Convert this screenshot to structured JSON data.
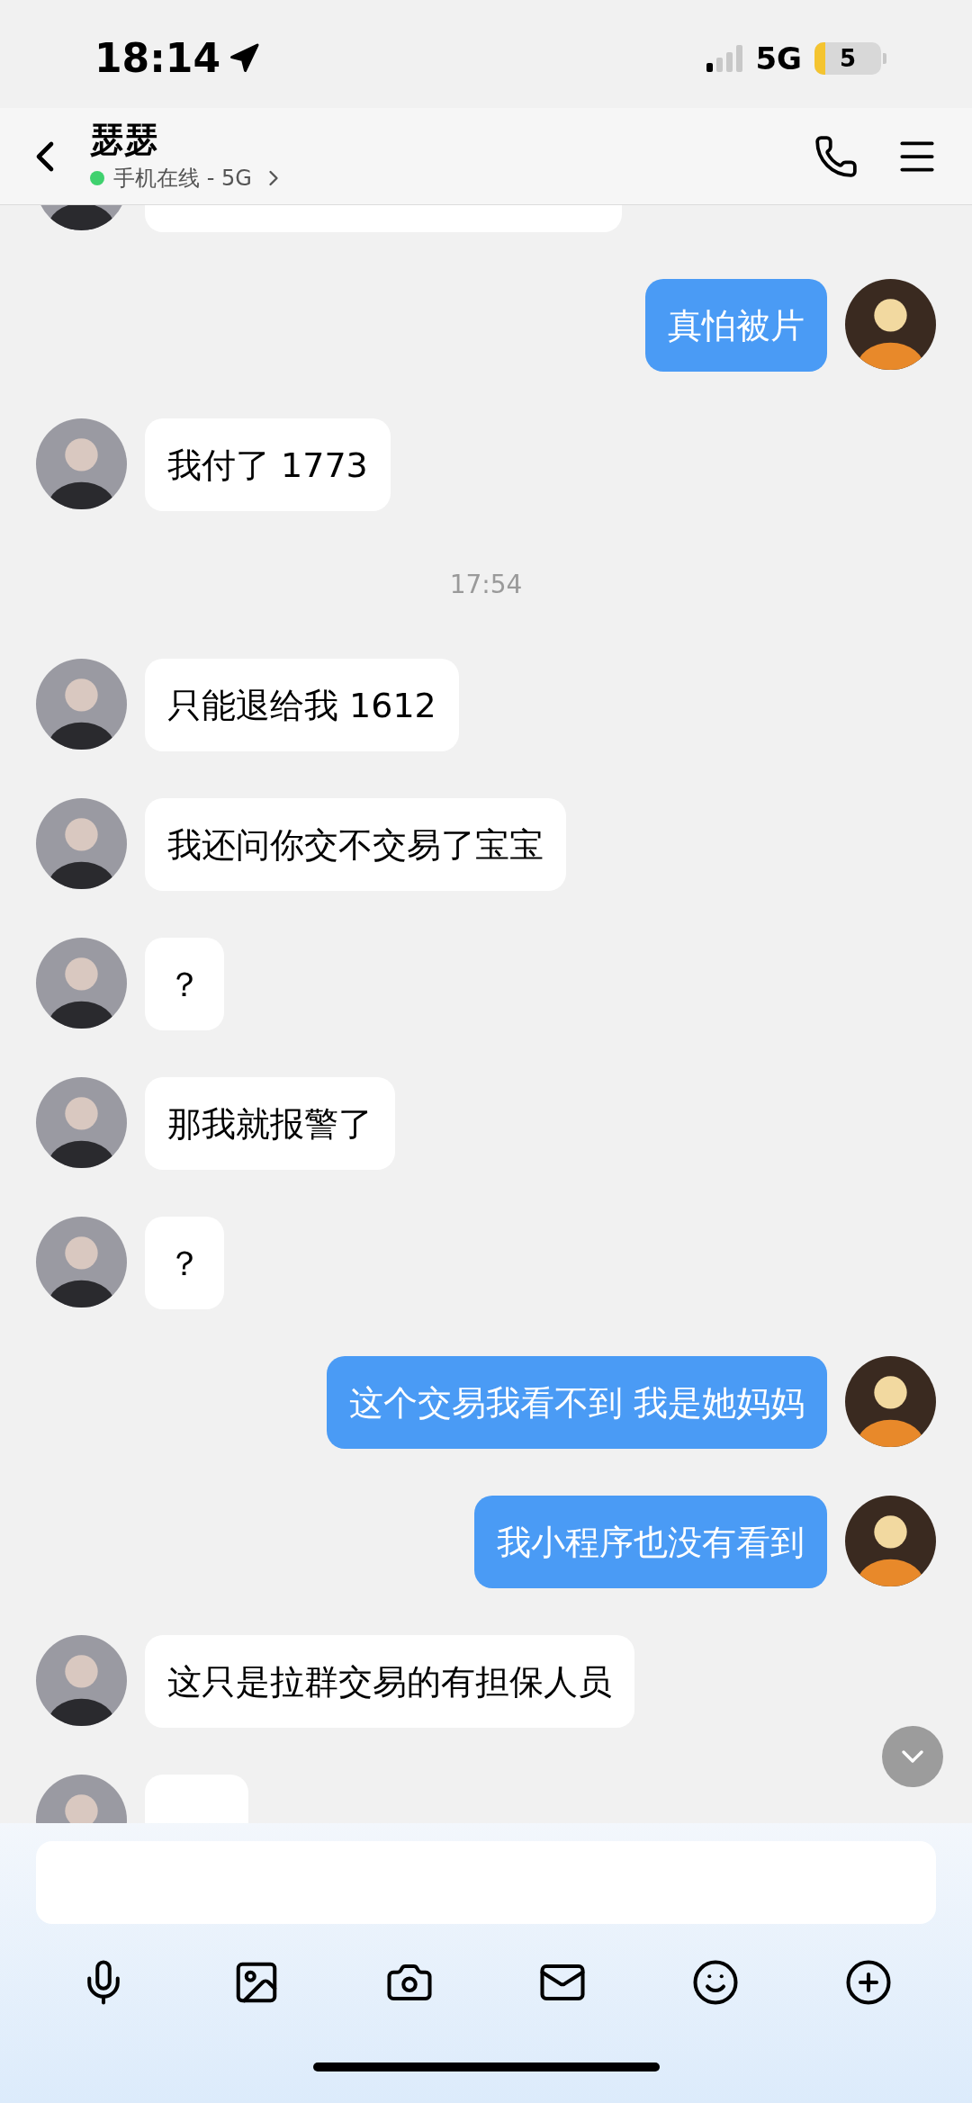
{
  "status_bar": {
    "time": "18:14",
    "network": "5G",
    "battery": "5"
  },
  "header": {
    "name": "瑟瑟",
    "status": "手机在线 - 5G"
  },
  "messages": [
    {
      "kind": "cut",
      "outgoing": false
    },
    {
      "kind": "text",
      "outgoing": true,
      "text": "真怕被片"
    },
    {
      "kind": "text",
      "outgoing": false,
      "text": "我付了 1773"
    },
    {
      "kind": "time",
      "text": "17:54"
    },
    {
      "kind": "text",
      "outgoing": false,
      "text": "只能退给我 1612"
    },
    {
      "kind": "text",
      "outgoing": false,
      "text": "我还问你交不交易了宝宝"
    },
    {
      "kind": "text",
      "outgoing": false,
      "text": "？"
    },
    {
      "kind": "text",
      "outgoing": false,
      "text": "那我就报警了"
    },
    {
      "kind": "text",
      "outgoing": false,
      "text": "？"
    },
    {
      "kind": "text",
      "outgoing": true,
      "text": "这个交易我看不到 我是她妈妈"
    },
    {
      "kind": "text",
      "outgoing": true,
      "text": "我小程序也没有看到"
    },
    {
      "kind": "text",
      "outgoing": false,
      "text": "这只是拉群交易的有担保人员"
    },
    {
      "kind": "cut",
      "outgoing": false
    }
  ]
}
